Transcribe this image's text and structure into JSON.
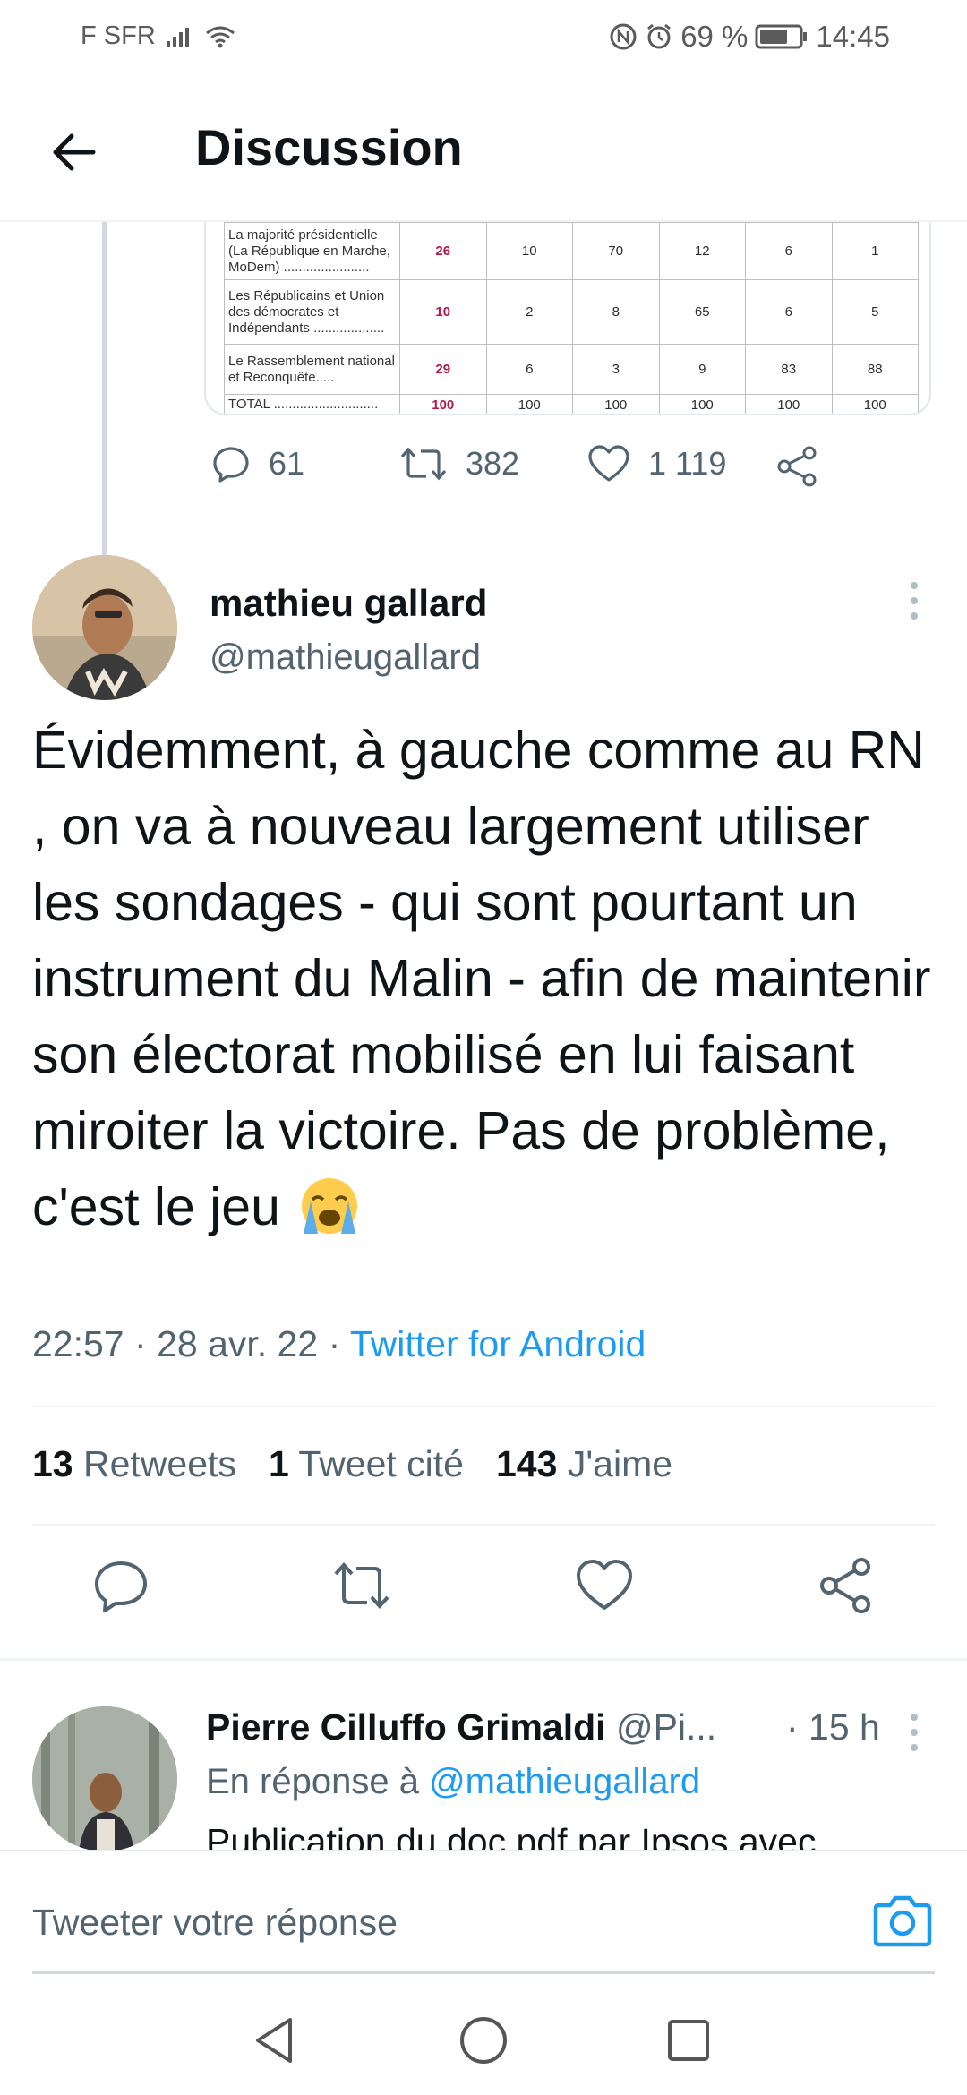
{
  "status_bar": {
    "carrier": "F SFR",
    "battery_percent": "69 %",
    "time": "14:45",
    "icons": [
      "signal-icon",
      "wifi-icon",
      "nfc-icon",
      "alarm-icon",
      "battery-icon"
    ]
  },
  "app_bar": {
    "title": "Discussion",
    "back_icon": "arrow-left-icon"
  },
  "embedded_table": {
    "rows": [
      {
        "label": "La majorité présidentielle (La République en Marche, MoDem) .......................",
        "values": [
          "26",
          "10",
          "70",
          "12",
          "6",
          "1"
        ]
      },
      {
        "label": "Les Républicains et Union des démocrates et Indépendants ...................",
        "values": [
          "10",
          "2",
          "8",
          "65",
          "6",
          "5"
        ]
      },
      {
        "label": "Le Rassemblement national et Reconquête.....",
        "values": [
          "29",
          "6",
          "3",
          "9",
          "83",
          "88"
        ]
      },
      {
        "label": "TOTAL ............................",
        "values": [
          "100",
          "100",
          "100",
          "100",
          "100",
          "100"
        ]
      }
    ]
  },
  "parent_tweet_actions": {
    "replies": "61",
    "retweets": "382",
    "likes": "1 119"
  },
  "tweet": {
    "author_name": "mathieu gallard",
    "author_handle": "@mathieugallard",
    "text": "Évidemment, à gauche comme au RN , on va à nouveau largement utiliser les sondages - qui sont pourtant un instrument du Malin - afin de maintenir son électorat mobilisé en lui faisant miroiter la victoire. Pas de problème, c'est le jeu",
    "emoji": "loudly-crying-face",
    "time": "22:57",
    "date": "28 avr. 22",
    "source": "Twitter for Android",
    "separator": "·",
    "stats": {
      "retweets_count": "13",
      "retweets_label": "Retweets",
      "quotes_count": "1",
      "quotes_label": "Tweet cité",
      "likes_count": "143",
      "likes_label": "J'aime"
    }
  },
  "reply": {
    "author_name": "Pierre Cilluffo Grimaldi",
    "author_handle": "@Pi...",
    "time": "· 15 h",
    "in_reply_prefix": "En réponse à",
    "in_reply_handle": "@mathieugallard",
    "text": "Publication du doc pdf par Ipsos avec"
  },
  "compose": {
    "placeholder": "Tweeter votre réponse"
  },
  "colors": {
    "accent": "#1d9bf0",
    "secondary_text": "#536471",
    "primary_text": "#0f1419",
    "divider": "#eff3f4"
  }
}
